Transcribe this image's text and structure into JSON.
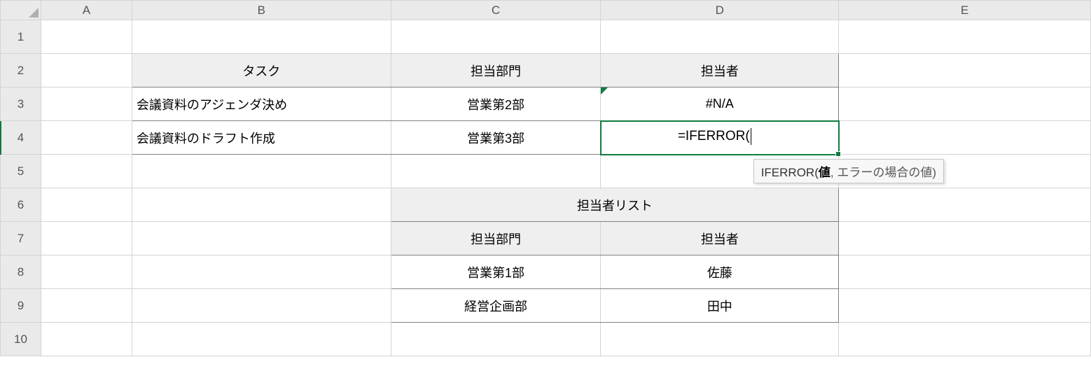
{
  "columns": [
    "A",
    "B",
    "C",
    "D",
    "E"
  ],
  "rows": [
    "1",
    "2",
    "3",
    "4",
    "5",
    "6",
    "7",
    "8",
    "9",
    "10"
  ],
  "active_cell": "D4",
  "formula_input": "=IFERROR(",
  "tooltip": {
    "fn": "IFERROR(",
    "arg_bold": "値",
    "sep": ", ",
    "arg_rest": "エラーの場合の値",
    "close": ")"
  },
  "cells": {
    "B2": "タスク",
    "C2": "担当部門",
    "D2": "担当者",
    "B3": "会議資料のアジェンダ決め",
    "C3": "営業第2部",
    "D3": "#N/A",
    "B4": "会議資料のドラフト作成",
    "C4": "営業第3部",
    "C6D6": "担当者リスト",
    "C7": "担当部門",
    "D7": "担当者",
    "C8": "営業第1部",
    "D8": "佐藤",
    "C9": "経営企画部",
    "D9": "田中"
  }
}
